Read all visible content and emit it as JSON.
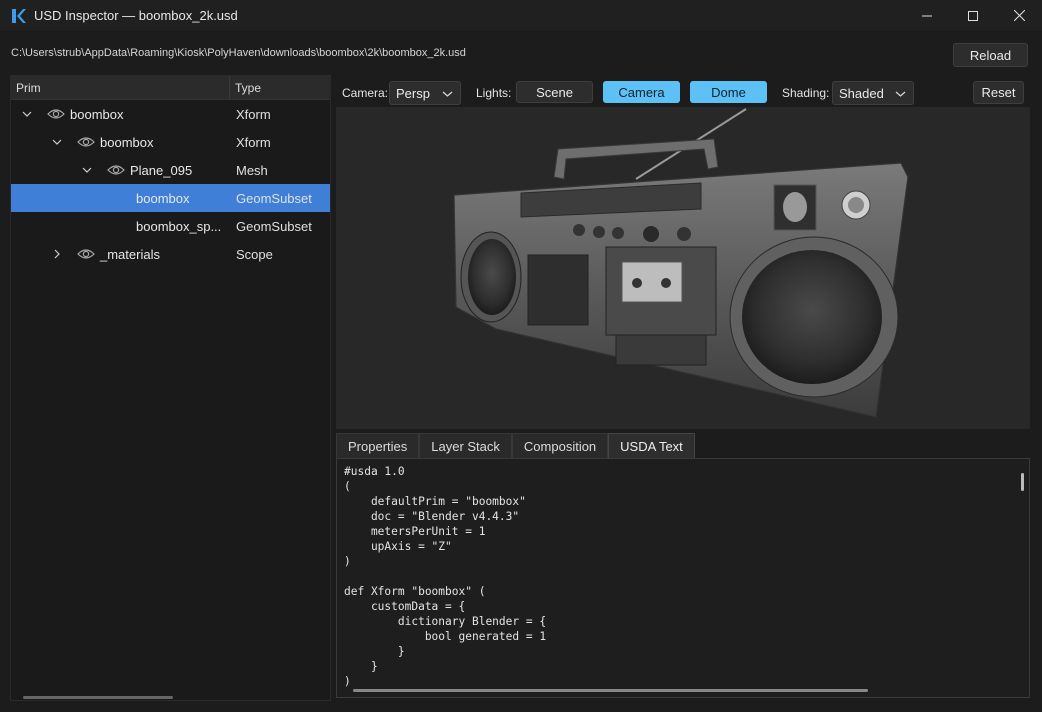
{
  "window": {
    "title": "USD Inspector — boombox_2k.usd",
    "controls": [
      "minimize-icon",
      "maximize-icon",
      "close-icon"
    ]
  },
  "pathbar": {
    "path": "C:\\Users\\strub\\AppData\\Roaming\\Kiosk\\PolyHaven\\downloads\\boombox\\2k\\boombox_2k.usd",
    "reload_label": "Reload"
  },
  "tree": {
    "headers": {
      "prim": "Prim",
      "type": "Type"
    },
    "rows": [
      {
        "name": "boombox",
        "type": "Xform",
        "expanded": true,
        "selected": false
      },
      {
        "name": "boombox",
        "type": "Xform",
        "expanded": true,
        "selected": false
      },
      {
        "name": "Plane_095",
        "type": "Mesh",
        "expanded": true,
        "selected": false
      },
      {
        "name": "boombox",
        "type": "GeomSubset",
        "selected": true
      },
      {
        "name": "boombox_sp...",
        "type": "GeomSubset",
        "selected": false
      },
      {
        "name": "_materials",
        "type": "Scope",
        "expanded": false,
        "selected": false
      }
    ]
  },
  "viewport_toolbar": {
    "camera_label": "Camera:",
    "camera_value": "Persp",
    "lights_label": "Lights:",
    "lights": [
      {
        "label": "Scene",
        "active": false
      },
      {
        "label": "Camera",
        "active": true
      },
      {
        "label": "Dome",
        "active": true
      }
    ],
    "shading_label": "Shading:",
    "shading_value": "Shaded",
    "reset_label": "Reset"
  },
  "tabs": [
    {
      "label": "Properties",
      "active": false
    },
    {
      "label": "Layer Stack",
      "active": false
    },
    {
      "label": "Composition",
      "active": false
    },
    {
      "label": "USDA Text",
      "active": true
    }
  ],
  "usda_text": "#usda 1.0\n(\n    defaultPrim = \"boombox\"\n    doc = \"Blender v4.4.3\"\n    metersPerUnit = 1\n    upAxis = \"Z\"\n)\n\ndef Xform \"boombox\" (\n    customData = {\n        dictionary Blender = {\n            bool generated = 1\n        }\n    }\n)",
  "colors": {
    "accent": "#5ec1f5",
    "selection": "#3f7fd8",
    "background": "#1c1c1c"
  }
}
